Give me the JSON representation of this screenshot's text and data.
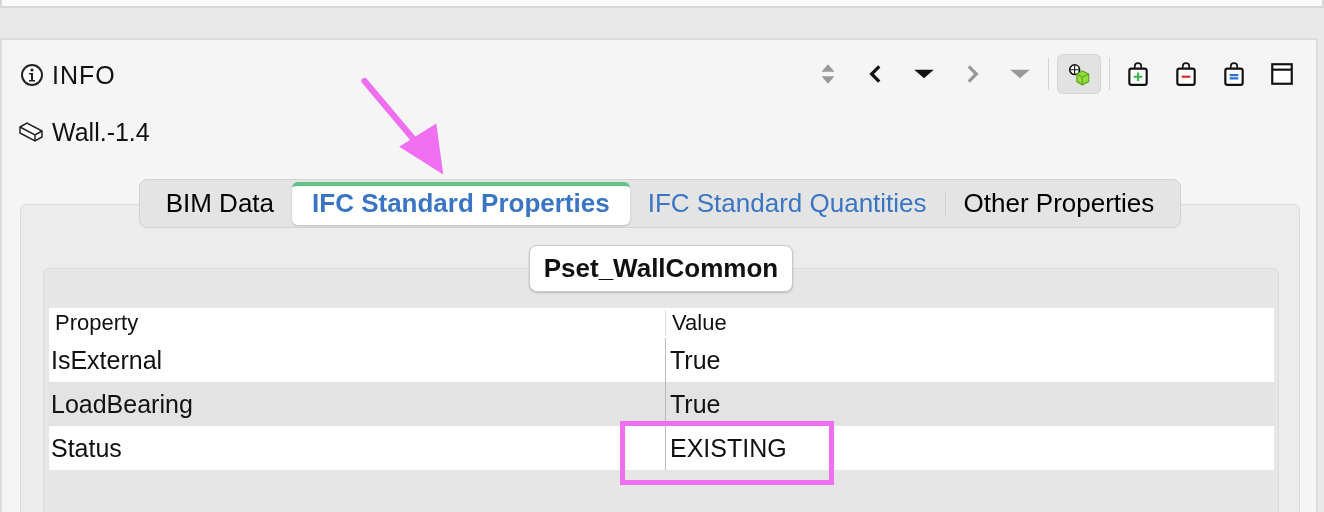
{
  "panel": {
    "title": "INFO"
  },
  "toolbar": [
    {
      "kind": "updown",
      "disabled": true
    },
    {
      "kind": "back",
      "disabled": false
    },
    {
      "kind": "dropdown",
      "disabled": false
    },
    {
      "kind": "forward",
      "disabled": true
    },
    {
      "kind": "dropdown",
      "disabled": true
    },
    {
      "kind": "separator"
    },
    {
      "kind": "cube",
      "pressed": true
    },
    {
      "kind": "separator"
    },
    {
      "kind": "bag-add"
    },
    {
      "kind": "bag-remove"
    },
    {
      "kind": "bag-equal"
    },
    {
      "kind": "window"
    }
  ],
  "element": {
    "name": "Wall.-1.4"
  },
  "tabs": [
    {
      "label": "BIM Data",
      "selected": false,
      "color": "#000000"
    },
    {
      "label": "IFC Standard Properties",
      "selected": true,
      "color": "#3a75c4"
    },
    {
      "label": "IFC Standard Quantities",
      "selected": false,
      "color": "#3a75c4"
    },
    {
      "label": "Other Properties",
      "selected": false,
      "color": "#000000"
    }
  ],
  "group": {
    "title": "Pset_WallCommon"
  },
  "table": {
    "columns": [
      "Property",
      "Value"
    ],
    "rows": [
      {
        "cells": [
          "IsExternal",
          "True"
        ],
        "selected": false
      },
      {
        "cells": [
          "LoadBearing",
          "True"
        ],
        "selected": true
      },
      {
        "cells": [
          "Status",
          "EXISTING"
        ],
        "selected": false
      }
    ]
  },
  "annotations": {
    "arrow": true,
    "highlight_box": true
  }
}
